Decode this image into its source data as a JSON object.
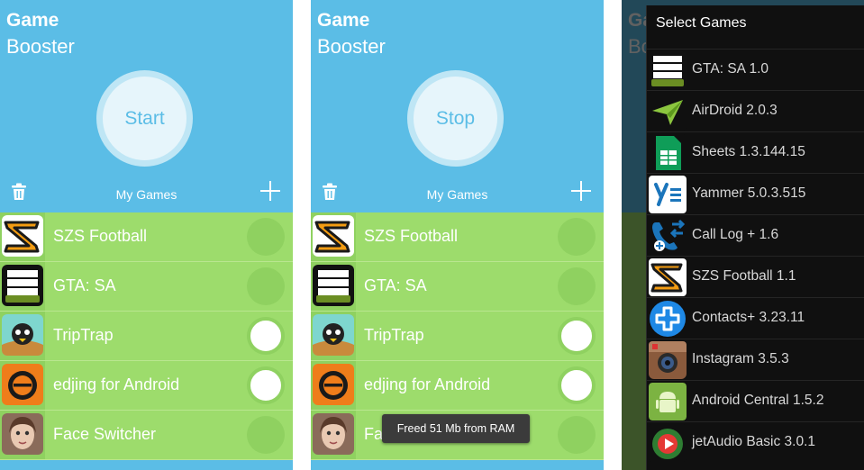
{
  "app": {
    "title_line1": "Game",
    "title_line2": "Booster"
  },
  "colors": {
    "header_blue": "#5bbde6",
    "list_green": "#9ddc6c",
    "toggle_green": "#8fd160"
  },
  "panel1": {
    "button_label": "Start",
    "section_label": "My Games",
    "games": [
      {
        "name": "SZS Football",
        "icon": "szs-football-icon",
        "toggle": "off"
      },
      {
        "name": "GTA: SA",
        "icon": "gta-sa-icon",
        "toggle": "off"
      },
      {
        "name": "TripTrap",
        "icon": "triptrap-icon",
        "toggle": "on"
      },
      {
        "name": "edjing for Android",
        "icon": "edjing-icon",
        "toggle": "on"
      },
      {
        "name": "Face Switcher",
        "icon": "face-switcher-icon",
        "toggle": "off"
      }
    ]
  },
  "panel2": {
    "button_label": "Stop",
    "section_label": "My Games",
    "toast": "Freed 51 Mb from RAM",
    "games": [
      {
        "name": "SZS Football",
        "icon": "szs-football-icon",
        "toggle": "off"
      },
      {
        "name": "GTA: SA",
        "icon": "gta-sa-icon",
        "toggle": "off"
      },
      {
        "name": "TripTrap",
        "icon": "triptrap-icon",
        "toggle": "on"
      },
      {
        "name": "edjing for Android",
        "icon": "edjing-icon",
        "toggle": "on"
      },
      {
        "name": "Fa",
        "icon": "face-switcher-icon",
        "toggle": "off"
      }
    ]
  },
  "panel3": {
    "bg_title_line1": "Ga",
    "bg_title_line2": "Bo",
    "dialog_title": "Select Games",
    "apps": [
      {
        "name": "GTA: SA 1.0",
        "icon": "gta-sa-icon"
      },
      {
        "name": "AirDroid 2.0.3",
        "icon": "airdroid-icon"
      },
      {
        "name": "Sheets 1.3.144.15",
        "icon": "sheets-icon"
      },
      {
        "name": "Yammer 5.0.3.515",
        "icon": "yammer-icon"
      },
      {
        "name": "Call Log + 1.6",
        "icon": "call-log-icon"
      },
      {
        "name": "SZS Football 1.1",
        "icon": "szs-football-icon"
      },
      {
        "name": "Contacts+ 3.23.11",
        "icon": "contacts-plus-icon"
      },
      {
        "name": "Instagram 3.5.3",
        "icon": "instagram-icon"
      },
      {
        "name": "Android Central 1.5.2",
        "icon": "android-central-icon"
      },
      {
        "name": "jetAudio Basic 3.0.1",
        "icon": "jetaudio-icon"
      }
    ]
  }
}
